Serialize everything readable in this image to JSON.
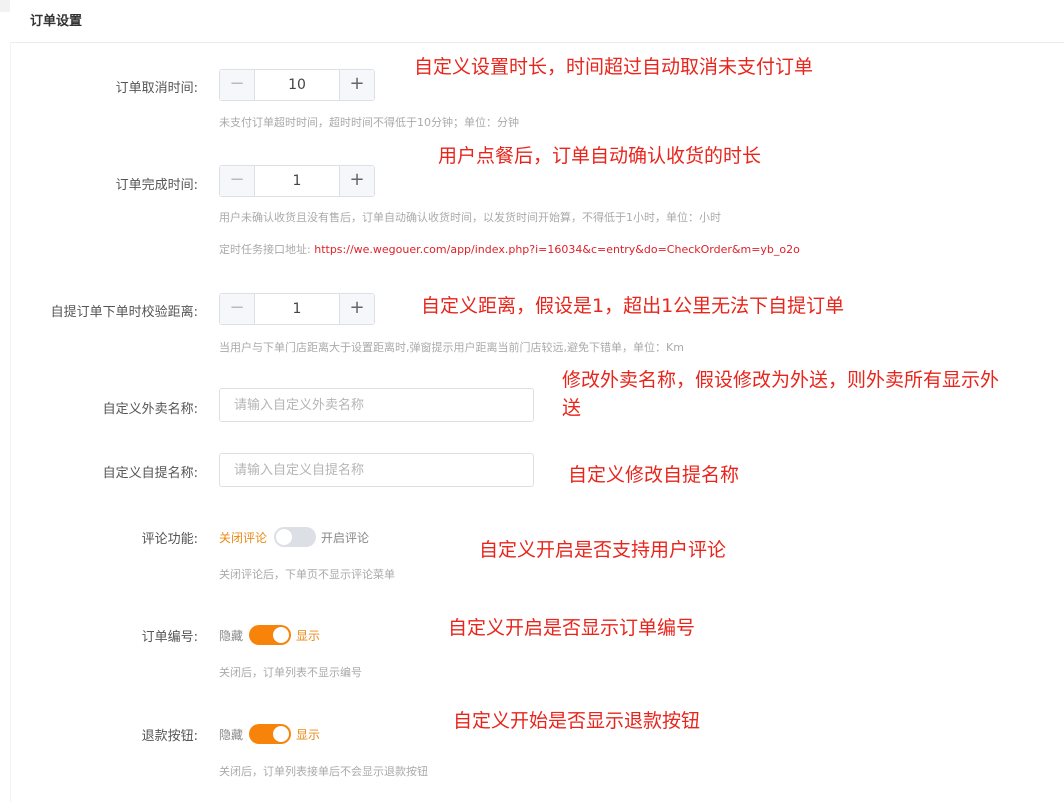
{
  "header": {
    "title": "订单设置"
  },
  "fields": {
    "cancel_time": {
      "label": "订单取消时间:",
      "value": "10",
      "minus": "−",
      "plus": "+",
      "hint": "未支付订单超时时间，超时时间不得低于10分钟；单位：分钟"
    },
    "complete_time": {
      "label": "订单完成时间:",
      "value": "1",
      "minus": "−",
      "plus": "+",
      "hint": "用户未确认收货且没有售后，订单自动确认收货时间，以发货时间开始算，不得低于1小时，单位：小时",
      "cron_label": "定时任务接口地址:",
      "cron_url": "https://we.wegouer.com/app/index.php?i=16034&c=entry&do=CheckOrder&m=yb_o2o"
    },
    "pickup_distance": {
      "label": "自提订单下单时校验距离:",
      "value": "1",
      "minus": "−",
      "plus": "+",
      "hint": "当用户与下单门店距离大于设置距离时,弹窗提示用户距离当前门店较远,避免下错单，单位：Km"
    },
    "delivery_name": {
      "label": "自定义外卖名称:",
      "value": "",
      "placeholder": "请输入自定义外卖名称"
    },
    "pickup_name": {
      "label": "自定义自提名称:",
      "value": "",
      "placeholder": "请输入自定义自提名称"
    },
    "comments": {
      "label": "评论功能:",
      "off_text": "关闭评论",
      "on_text": "开启评论",
      "enabled": false,
      "hint": "关闭评论后，下单页不显示评论菜单"
    },
    "order_number": {
      "label": "订单编号:",
      "off_text": "隐藏",
      "on_text": "显示",
      "enabled": true,
      "hint": "关闭后，订单列表不显示编号"
    },
    "refund_button": {
      "label": "退款按钮:",
      "off_text": "隐藏",
      "on_text": "显示",
      "enabled": true,
      "hint": "关闭后，订单列表接单后不会显示退款按钮"
    }
  },
  "annotations": {
    "cancel_time": "自定义设置时长，时间超过自动取消未支付订单",
    "complete_time": "用户点餐后，订单自动确认收货的时长",
    "pickup_distance": "自定义距离，假设是1，超出1公里无法下自提订单",
    "delivery_name_line1": "修改外卖名称，假设修改为外送，则外卖所有显示外",
    "delivery_name_line2": "送",
    "pickup_name": "自定义修改自提名称",
    "comments": "自定义开启是否支持用户评论",
    "order_number": "自定义开启是否显示订单编号",
    "refund_button": "自定义开始是否显示退款按钮"
  },
  "colors": {
    "accent": "#f7830b",
    "annotation": "#e8251c",
    "url": "#e0202a",
    "hint": "#aaaaaa"
  }
}
